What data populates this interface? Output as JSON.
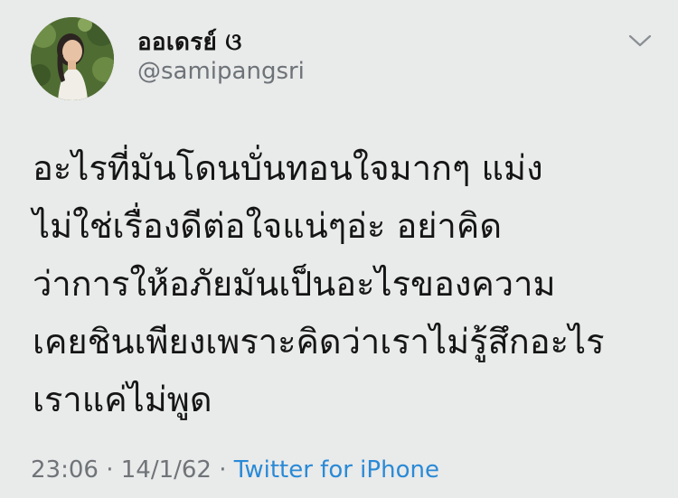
{
  "tweet": {
    "display_name": "ออเดรย์ ଓ",
    "handle": "@samipangsri",
    "body_lines": [
      "อะไรที่มันโดนบั่นทอนใจมากๆ แม่ง",
      "ไม่ใช่เรื่องดีต่อใจแน่ๆอ่ะ อย่าคิด",
      "ว่าการให้อภัยมันเป็นอะไรของความ",
      "เคยชินเพียงเพราะคิดว่าเราไม่รู้สึกอะไร",
      "เราแค่ไม่พูด"
    ],
    "time": "23:06",
    "separator": "·",
    "date": "14/1/62",
    "source": "Twitter for iPhone"
  },
  "icons": {
    "avatar": "profile-photo",
    "menu": "chevron-down-icon"
  },
  "colors": {
    "background": "#e9eaea",
    "text": "#151515",
    "secondary": "#6e7378",
    "link": "#2a8ad6"
  }
}
